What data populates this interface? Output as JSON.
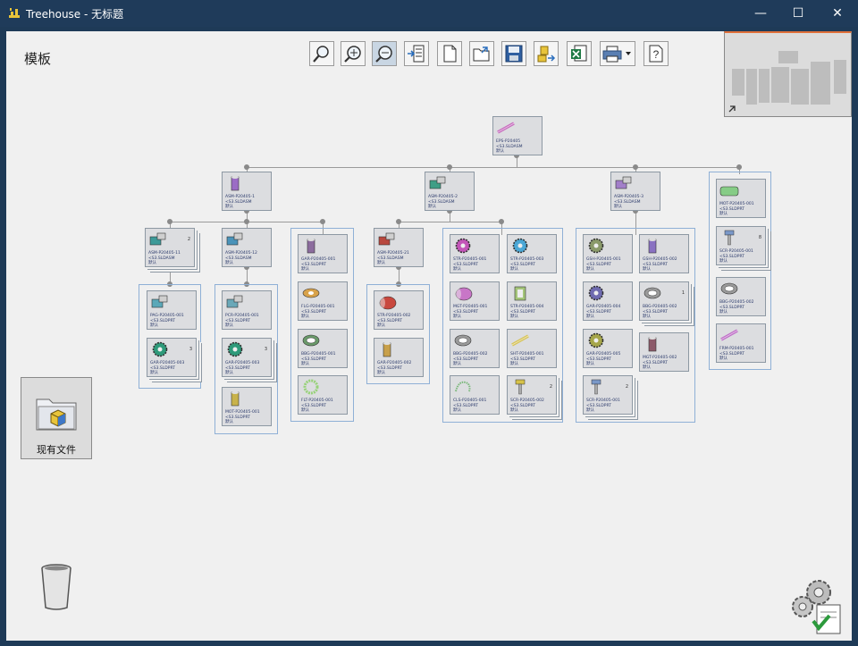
{
  "window": {
    "title": "Treehouse - 无标题",
    "minimize_glyph": "—",
    "maximize_glyph": "☐",
    "close_glyph": "✕"
  },
  "canvas": {
    "template_label": "模板",
    "existing_files_label": "现有文件"
  },
  "toolbar": {
    "tools": [
      {
        "name": "zoom-fit-tool",
        "icon": "zoom-fit-icon",
        "active": false
      },
      {
        "name": "zoom-in-tool",
        "icon": "zoom-in-icon",
        "active": false
      },
      {
        "name": "zoom-out-tool",
        "icon": "zoom-out-icon",
        "active": true
      },
      {
        "name": "insert-tool",
        "icon": "insert-icon",
        "active": false
      },
      {
        "name": "new-tool",
        "icon": "new-document-icon",
        "active": false
      },
      {
        "name": "open-tool",
        "icon": "open-folder-icon",
        "active": false
      },
      {
        "name": "save-tool",
        "icon": "save-icon",
        "active": false
      },
      {
        "name": "build-tool",
        "icon": "build-icon",
        "active": false
      },
      {
        "name": "excel-tool",
        "icon": "excel-export-icon",
        "active": false
      },
      {
        "name": "print-tool",
        "icon": "print-icon",
        "active": false
      },
      {
        "name": "help-tool",
        "icon": "help-icon",
        "active": false
      }
    ]
  },
  "tree": {
    "nodes": [
      {
        "id": "root",
        "name": "EPS-P20405",
        "sub": "<S3.SLDASM",
        "flag": "默认",
        "icon": "shaft",
        "color": "#c86fbf"
      },
      {
        "id": "asm1",
        "name": "ASM-P20405-1",
        "sub": "<S3.SLDASM",
        "flag": "默认",
        "icon": "post",
        "color": "#9b6cc5"
      },
      {
        "id": "asm2",
        "name": "ASM-P20405-2",
        "sub": "<S3.SLDASM",
        "flag": "默认",
        "icon": "assy",
        "color": "#3f9e86"
      },
      {
        "id": "asm3",
        "name": "ASM-P20405-3",
        "sub": "<S3.SLDASM",
        "flag": "默认",
        "icon": "assy",
        "color": "#a27fc9"
      },
      {
        "id": "mot1",
        "name": "MOT-P20405-001",
        "sub": "<S3.SLDPRT",
        "flag": "默认",
        "icon": "motor",
        "color": "#86cc86"
      },
      {
        "id": "asm11",
        "name": "ASM-P20405-11",
        "sub": "<S3.SLDASM",
        "flag": "默认",
        "icon": "assy",
        "color": "#3d9a98",
        "count": "2"
      },
      {
        "id": "asm12",
        "name": "ASM-P20405-12",
        "sub": "<S3.SLDASM",
        "flag": "默认",
        "icon": "assy",
        "color": "#4a93b9"
      },
      {
        "id": "gar001",
        "name": "GAR-P20405-001",
        "sub": "<S3.SLDPRT",
        "flag": "默认",
        "icon": "post",
        "color": "#8c6c9e"
      },
      {
        "id": "flg001",
        "name": "FLG-P20405-001",
        "sub": "<S3.SLDPRT",
        "flag": "默认",
        "icon": "flange",
        "color": "#d8a24a"
      },
      {
        "id": "bbg001",
        "name": "BBG-P20405-001",
        "sub": "<S3.SLDPRT",
        "flag": "默认",
        "icon": "bearing",
        "color": "#6a9a6a"
      },
      {
        "id": "flt001",
        "name": "FLT-P20405-001",
        "sub": "<S3.SLDPRT",
        "flag": "默认",
        "icon": "ring",
        "color": "#98d27a"
      },
      {
        "id": "asm21",
        "name": "ASM-P20405-21",
        "sub": "<S3.SLDASM",
        "flag": "默认",
        "icon": "assy",
        "color": "#b8483e"
      },
      {
        "id": "str001",
        "name": "STR-P20405-001",
        "sub": "<S3.SLDPRT",
        "flag": "默认",
        "icon": "gear",
        "color": "#c355b8"
      },
      {
        "id": "str003",
        "name": "STR-P20405-003",
        "sub": "<S3.SLDPRT",
        "flag": "默认",
        "icon": "gear",
        "color": "#4aa7d6"
      },
      {
        "id": "mgt001",
        "name": "MGT-P20405-001",
        "sub": "<S3.SLDPRT",
        "flag": "默认",
        "icon": "cylinder",
        "color": "#c876c7"
      },
      {
        "id": "str004",
        "name": "STR-P20405-004",
        "sub": "<S3.SLDPRT",
        "flag": "默认",
        "icon": "block",
        "color": "#a4c57a"
      },
      {
        "id": "bbg002a",
        "name": "BBG-P20405-002",
        "sub": "<S3.SLDPRT",
        "flag": "默认",
        "icon": "bearing",
        "color": "#9a9a9a"
      },
      {
        "id": "sht001",
        "name": "SHT-P20405-001",
        "sub": "<S3.SLDPRT",
        "flag": "默认",
        "icon": "shaft",
        "color": "#d7c45a"
      },
      {
        "id": "cls001",
        "name": "CLS-P20405-001",
        "sub": "<S3.SLDPRT",
        "flag": "默认",
        "icon": "clip",
        "color": "#7ab87a"
      },
      {
        "id": "scr002",
        "name": "SCR-P20405-002",
        "sub": "<S3.SLDPRT",
        "flag": "默认",
        "icon": "screw",
        "color": "#d6c24a",
        "count": "2"
      },
      {
        "id": "gsh001",
        "name": "GSH-P20405-001",
        "sub": "<S3.SLDPRT",
        "flag": "默认",
        "icon": "gear",
        "color": "#8a9a6a"
      },
      {
        "id": "gsh002",
        "name": "GSH-P20405-002",
        "sub": "<S3.SLDPRT",
        "flag": "默认",
        "icon": "post",
        "color": "#8a72c2"
      },
      {
        "id": "gar004",
        "name": "GAR-P20405-004",
        "sub": "<S3.SLDPRT",
        "flag": "默认",
        "icon": "gear",
        "color": "#6f6bb0"
      },
      {
        "id": "bbg002b",
        "name": "BBG-P20405-002",
        "sub": "<S3.SLDPRT",
        "flag": "默认",
        "icon": "bearing",
        "color": "#9a9a9a",
        "count": "1"
      },
      {
        "id": "gar005",
        "name": "GAR-P20405-005",
        "sub": "<S3.SLDPRT",
        "flag": "默认",
        "icon": "gear",
        "color": "#a6a64a"
      },
      {
        "id": "mgt002",
        "name": "MGT-P20405-002",
        "sub": "<S3.SLDPRT",
        "flag": "默认",
        "icon": "post",
        "color": "#8c5a6a"
      },
      {
        "id": "scr001b",
        "name": "SCR-P20405-001",
        "sub": "<S3.SLDPRT",
        "flag": "默认",
        "icon": "screw",
        "color": "#7a98c8",
        "count": "2"
      },
      {
        "id": "scr001c",
        "name": "SCR-P20405-001",
        "sub": "<S3.SLDPRT",
        "flag": "默认",
        "icon": "screw",
        "color": "#7a98c8",
        "count": "8"
      },
      {
        "id": "bbg002c",
        "name": "BBG-P20405-002",
        "sub": "<S3.SLDPRT",
        "flag": "默认",
        "icon": "bearing",
        "color": "#9a9a9a"
      },
      {
        "id": "frm001",
        "name": "FRM-P20405-001",
        "sub": "<S3.SLDPRT",
        "flag": "默认",
        "icon": "shaft",
        "color": "#c070c8"
      },
      {
        "id": "pag001",
        "name": "PAG-P20405-001",
        "sub": "<S3.SLDPRT",
        "flag": "默认",
        "icon": "assy",
        "color": "#5aa8b8"
      },
      {
        "id": "gar003a",
        "name": "GAR-P20405-003",
        "sub": "<S3.SLDPRT",
        "flag": "默认",
        "icon": "gear",
        "color": "#2e9a7a",
        "count": "3"
      },
      {
        "id": "pcr001",
        "name": "PCR-P20405-001",
        "sub": "<S3.SLDPRT",
        "flag": "默认",
        "icon": "assy",
        "color": "#6aa8b8"
      },
      {
        "id": "gar003b",
        "name": "GAR-P20405-003",
        "sub": "<S3.SLDPRT",
        "flag": "默认",
        "icon": "gear",
        "color": "#2e9a7a",
        "count": "3"
      },
      {
        "id": "mot001b",
        "name": "MOT-P20405-001",
        "sub": "<S3.SLDPRT",
        "flag": "默认",
        "icon": "post",
        "color": "#c8b24a"
      },
      {
        "id": "str002",
        "name": "STR-P20405-002",
        "sub": "<S3.SLDPRT",
        "flag": "默认",
        "icon": "cylinder",
        "color": "#c8483e"
      },
      {
        "id": "gar002",
        "name": "GAR-P20405-002",
        "sub": "<S3.SLDPRT",
        "flag": "默认",
        "icon": "post",
        "color": "#c8a04a"
      }
    ]
  }
}
